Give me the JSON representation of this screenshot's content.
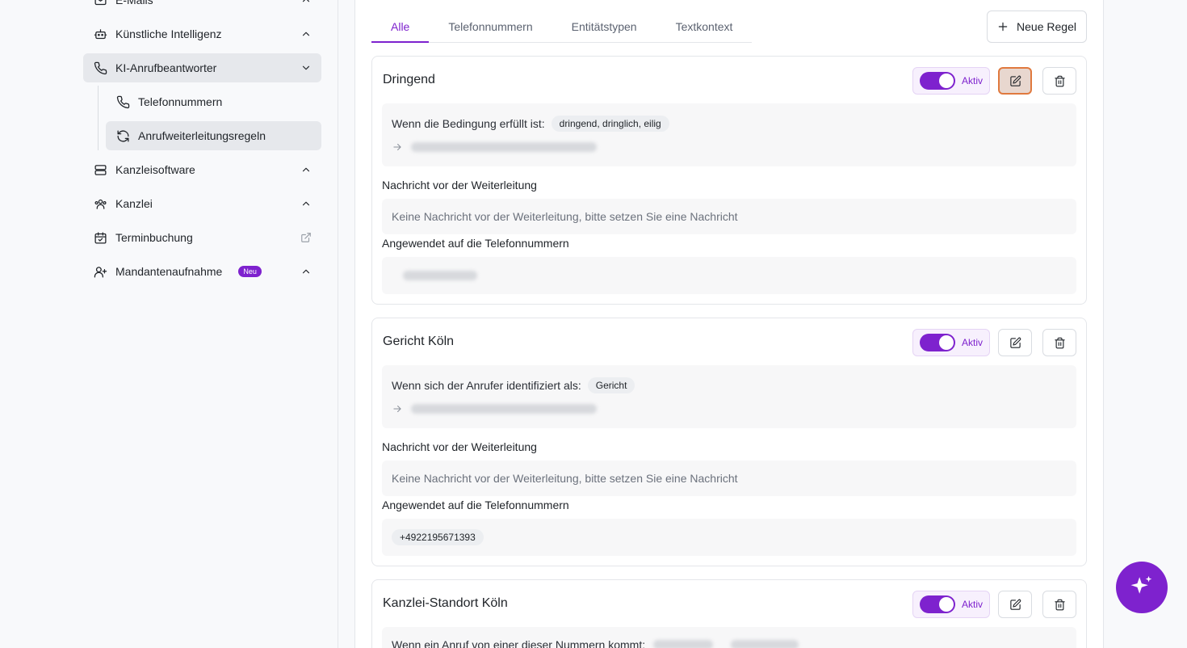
{
  "sidebar": {
    "items": [
      {
        "label": "E-Mails"
      },
      {
        "label": "Künstliche Intelligenz"
      },
      {
        "label": "KI-Anrufbeantworter"
      },
      {
        "label": "Telefonnummern"
      },
      {
        "label": "Anrufweiterleitungsregeln"
      },
      {
        "label": "Kanzleisoftware"
      },
      {
        "label": "Kanzlei"
      },
      {
        "label": "Terminbuchung"
      },
      {
        "label": "Mandantenaufnahme",
        "badge": "Neu"
      }
    ]
  },
  "tabs": [
    "Alle",
    "Telefonnummern",
    "Entitätstypen",
    "Textkontext"
  ],
  "new_rule_label": "Neue Regel",
  "status_label": "Aktiv",
  "colors": {
    "accent": "#7e22ce",
    "focus": "#e0793e"
  },
  "section_labels": {
    "message": "Nachricht vor der Weiterleitung",
    "applied": "Angewendet auf die Telefonnummern"
  },
  "rules": [
    {
      "title": "Dringend",
      "condition": "Wenn die Bedingung erfüllt ist:",
      "chips": [
        "dringend, dringlich, eilig"
      ],
      "message_placeholder": "Keine Nachricht vor der Weiterleitung, bitte setzen Sie eine Nachricht",
      "phones": []
    },
    {
      "title": "Gericht Köln",
      "condition": "Wenn sich der Anrufer identifiziert als:",
      "chips": [
        "Gericht"
      ],
      "message_placeholder": "Keine Nachricht vor der Weiterleitung, bitte setzen Sie eine Nachricht",
      "phones": [
        "+4922195671393"
      ]
    },
    {
      "title": "Kanzlei-Standort Köln",
      "condition": "Wenn ein Anruf von einer dieser Nummern kommt:"
    }
  ]
}
